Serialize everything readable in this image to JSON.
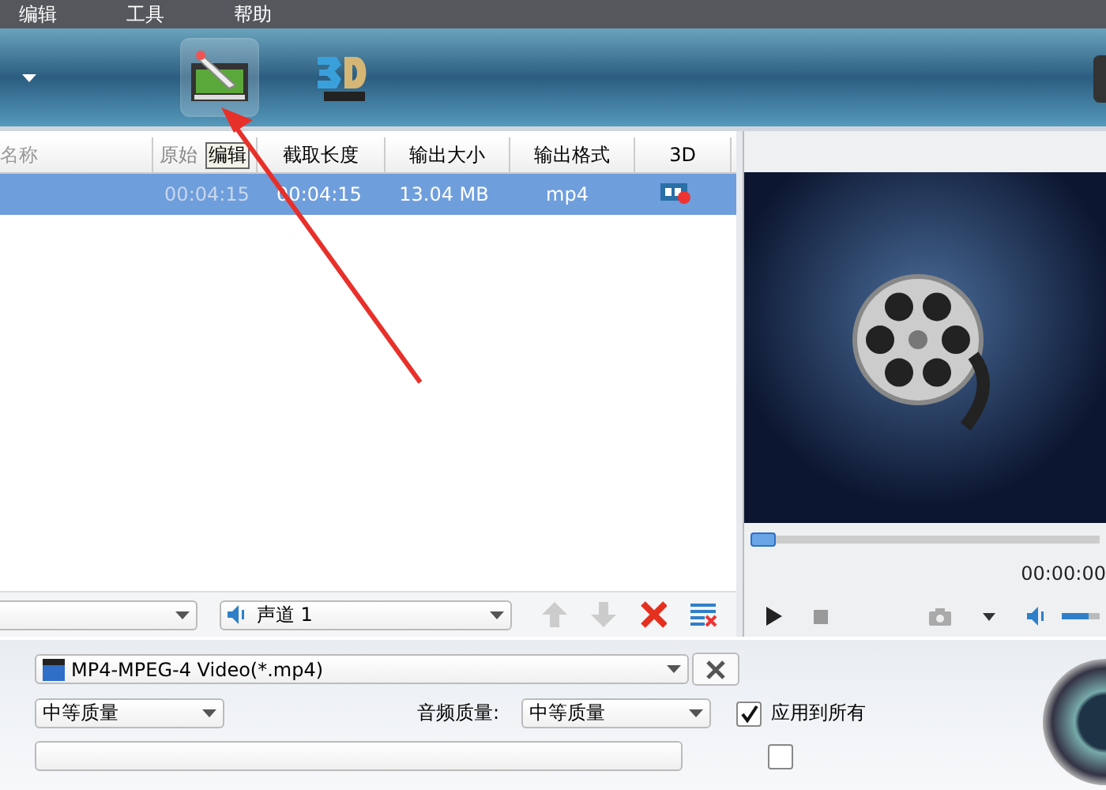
{
  "menu": [
    "编辑",
    "工具",
    "帮助"
  ],
  "toolbar": {
    "buttons": [
      {
        "kind": "edit",
        "selected": true
      },
      {
        "kind": "stereo",
        "selected": false
      }
    ]
  },
  "table": {
    "columns": [
      "名称",
      "原始",
      "截取长度",
      "输出大小",
      "输出格式",
      "3D"
    ],
    "tooltip": "编辑",
    "rows": [
      {
        "selected": true,
        "cells": [
          "",
          "00:04:15",
          "00:04:15",
          "13.04 MB",
          "mp4"
        ]
      }
    ]
  },
  "audio_track": "声道 1",
  "preview": {
    "seek": {
      "level": 0
    },
    "volume": {
      "level": 0.7
    },
    "time": "00:00:00"
  },
  "settings": {
    "format": "MP4-MPEG-4 Video(*.mp4)",
    "video_quality": "中等质量",
    "audio_quality_label": "音频质量:",
    "audio_quality": "中等质量",
    "options": [
      {
        "label": "应用到所有",
        "checked": true
      },
      {
        "checked": false
      }
    ]
  }
}
